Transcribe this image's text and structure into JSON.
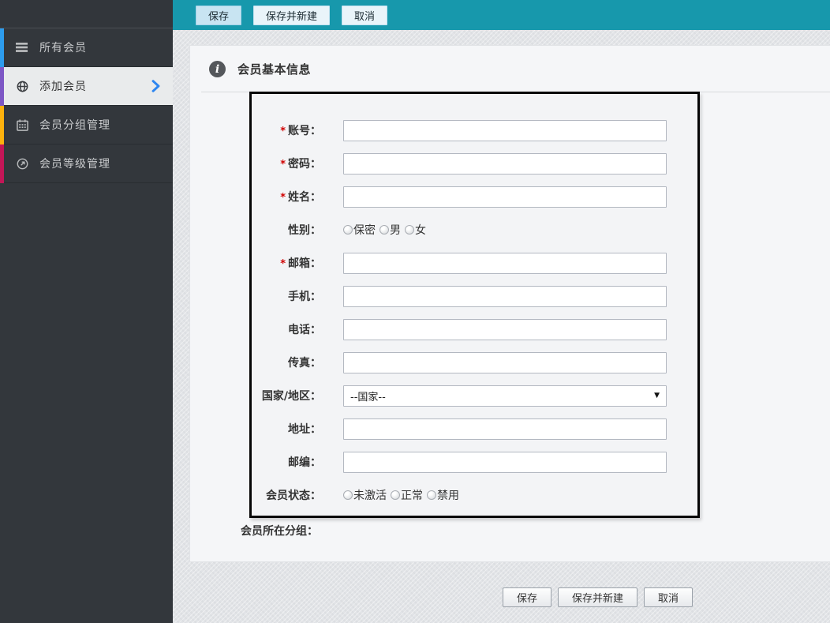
{
  "sidebar": {
    "items": [
      {
        "label": "所有会员",
        "icon": "list-icon",
        "accent": "#2d9ced",
        "active": false
      },
      {
        "label": "添加会员",
        "icon": "globe-icon",
        "accent": "#7d57c5",
        "active": true
      },
      {
        "label": "会员分组管理",
        "icon": "calendar-icon",
        "accent": "#fcb10d",
        "active": false
      },
      {
        "label": "会员等级管理",
        "icon": "gauge-icon",
        "accent": "#c31657",
        "active": false
      }
    ]
  },
  "topbar": {
    "background": "#1798ac",
    "buttons": [
      {
        "label": "保存"
      },
      {
        "label": "保存并新建"
      },
      {
        "label": "取消"
      }
    ]
  },
  "panel": {
    "title": "会员基本信息",
    "required_mark": "*",
    "fields": [
      {
        "label": "账号：",
        "required": true,
        "type": "text"
      },
      {
        "label": "密码：",
        "required": true,
        "type": "text"
      },
      {
        "label": "姓名：",
        "required": true,
        "type": "text"
      },
      {
        "label": "性别：",
        "required": false,
        "type": "radio",
        "options": [
          "保密",
          "男",
          "女"
        ]
      },
      {
        "label": "邮箱：",
        "required": true,
        "type": "text"
      },
      {
        "label": "手机：",
        "required": false,
        "type": "text"
      },
      {
        "label": "电话：",
        "required": false,
        "type": "text"
      },
      {
        "label": "传真：",
        "required": false,
        "type": "text"
      },
      {
        "label": "国家/地区：",
        "required": false,
        "type": "select",
        "value": "--国家--"
      },
      {
        "label": "地址：",
        "required": false,
        "type": "text"
      },
      {
        "label": "邮编：",
        "required": false,
        "type": "text"
      },
      {
        "label": "会员状态：",
        "required": false,
        "type": "radio",
        "options": [
          "未激活",
          "正常",
          "禁用"
        ]
      }
    ],
    "group_label": "会员所在分组："
  },
  "footer": {
    "buttons": [
      {
        "label": "保存"
      },
      {
        "label": "保存并新建"
      },
      {
        "label": "取消"
      }
    ]
  }
}
